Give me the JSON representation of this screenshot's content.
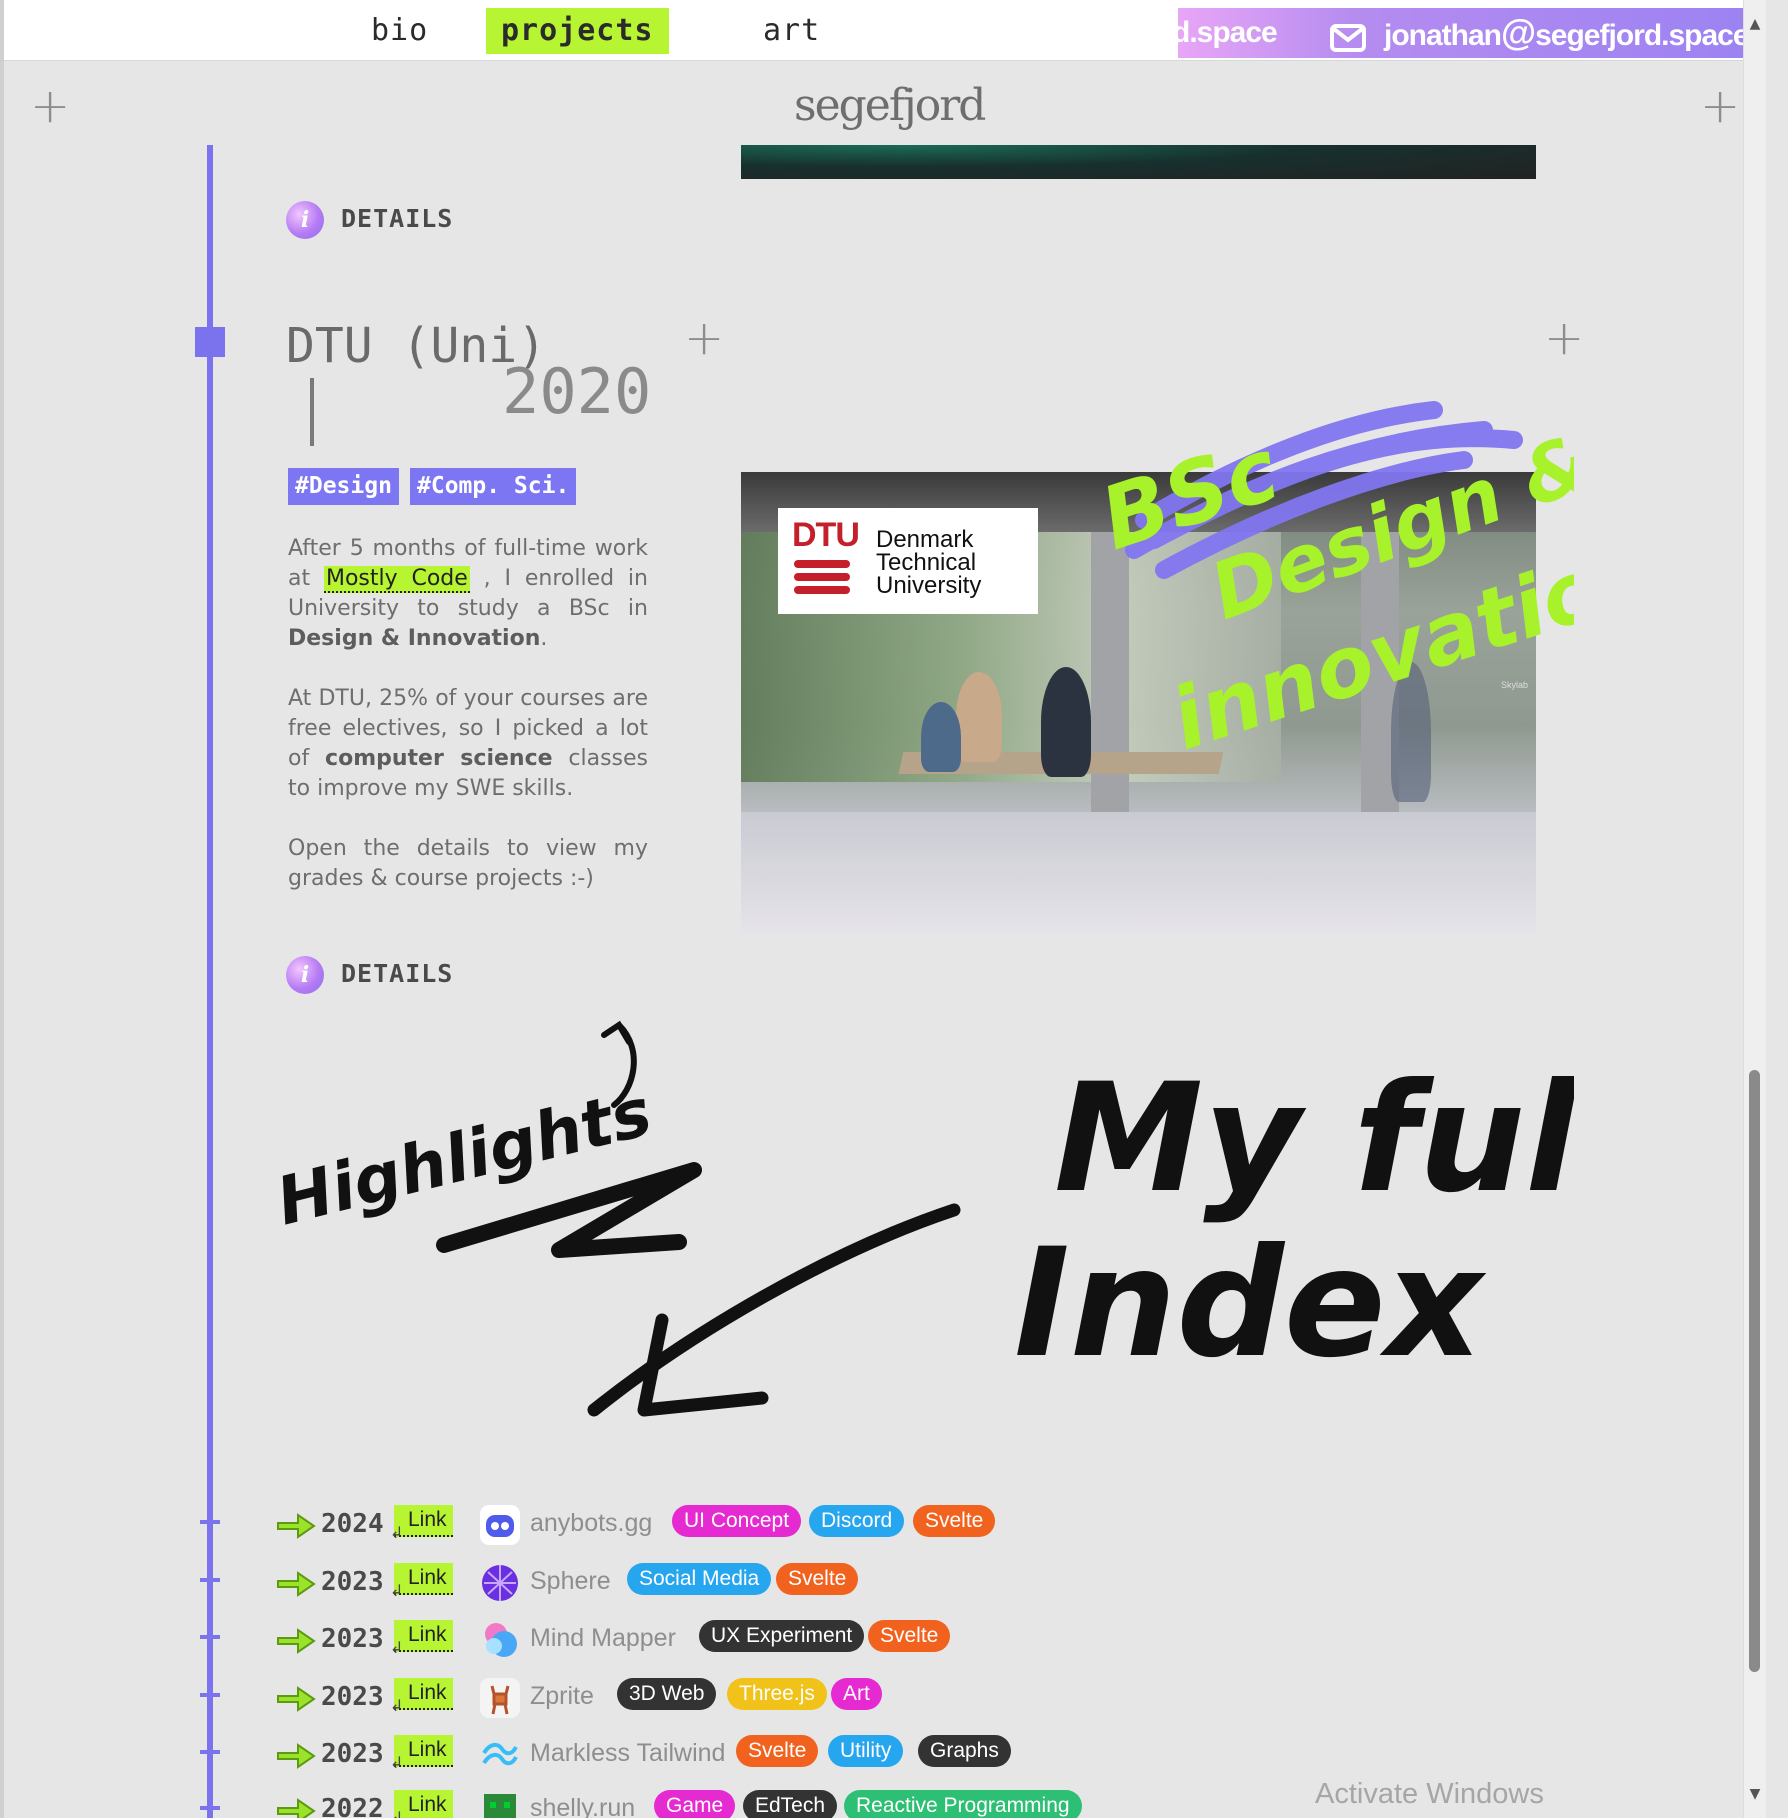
{
  "nav": {
    "links": [
      {
        "label": "bio",
        "active": false
      },
      {
        "label": "projects",
        "active": true
      },
      {
        "label": "art",
        "active": false
      }
    ],
    "marquee": {
      "prev_fragment": "d.space",
      "address_user": "jonathan",
      "address_at": "@",
      "address_domain": "segefjord.space",
      "icon": "mail-icon"
    }
  },
  "logo": "segefjord",
  "details_label": "DETAILS",
  "project": {
    "title": "DTU (Uni)",
    "year": "2020",
    "tags": [
      "#Design",
      "#Comp. Sci."
    ],
    "desc": {
      "p1_a": "After 5 months of full-time work at",
      "p1_link": "Mostly Code",
      "p1_b": ", I enrolled in University to study a BSc in",
      "p1_bold": "Design & Innovation",
      "p1_end": ".",
      "p2_a": "At DTU, 25% of your courses are free electives, so I picked a lot of",
      "p2_bold": "computer science",
      "p2_b": "classes to improve my SWE skills.",
      "p3": "Open the details to view my grades & course projects :-)"
    },
    "image": {
      "logo_text": "DTU",
      "name_lines": [
        "Denmark",
        "Technical",
        "University"
      ],
      "sign": "Skylab",
      "overlay_line1": "BSc",
      "overlay_line2": "Design &",
      "overlay_line3": "innovation"
    }
  },
  "annotations": {
    "highlights": "Highlights",
    "full_line1": "My full",
    "full_line2": "Index"
  },
  "index": {
    "link_label": "Link",
    "rows": [
      {
        "year": "2024",
        "name": "anybots.gg",
        "icon": "anybots-icon",
        "tags": [
          {
            "label": "UI Concept",
            "color": "#e62ad1"
          },
          {
            "label": "Discord",
            "color": "#27a6f0"
          },
          {
            "label": "Svelte",
            "color": "#f2621f"
          }
        ]
      },
      {
        "year": "2023",
        "name": "Sphere",
        "icon": "sphere-icon",
        "tags": [
          {
            "label": "Social Media",
            "color": "#27a6f0"
          },
          {
            "label": "Svelte",
            "color": "#f2621f"
          }
        ]
      },
      {
        "year": "2023",
        "name": "Mind Mapper",
        "icon": "mind-mapper-icon",
        "tags": [
          {
            "label": "UX Experiment",
            "color": "#333333"
          },
          {
            "label": "Svelte",
            "color": "#f2621f"
          }
        ]
      },
      {
        "year": "2023",
        "name": "Zprite",
        "icon": "zprite-icon",
        "tags": [
          {
            "label": "3D Web",
            "color": "#333333"
          },
          {
            "label": "Three.js",
            "color": "#f0c21a"
          },
          {
            "label": "Art",
            "color": "#e62ad1"
          }
        ]
      },
      {
        "year": "2023",
        "name": "Markless Tailwind",
        "icon": "tailwind-icon",
        "tags": [
          {
            "label": "Svelte",
            "color": "#f2621f"
          },
          {
            "label": "Utility",
            "color": "#27a6f0"
          },
          {
            "label": "Graphs",
            "color": "#333333"
          }
        ]
      },
      {
        "year": "2022",
        "name": "shelly.run",
        "icon": "shelly-icon",
        "tags": [
          {
            "label": "Game",
            "color": "#e62ad1"
          },
          {
            "label": "EdTech",
            "color": "#333333"
          },
          {
            "label": "Reactive Programming",
            "color": "#2dbf73"
          }
        ]
      }
    ]
  },
  "os_watermark": "Activate Windows"
}
